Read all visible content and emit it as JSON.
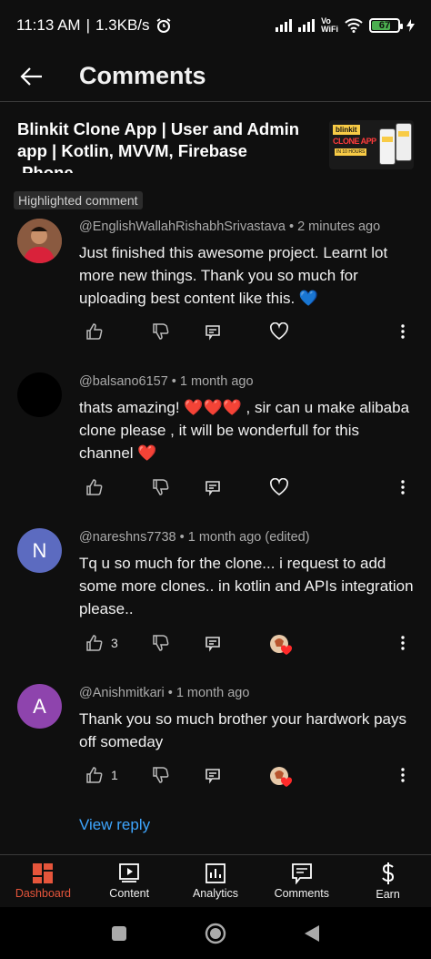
{
  "status_bar": {
    "time": "11:13 AM",
    "speed": "1.3KB/s",
    "volte": "Vo\nWiFi",
    "battery": "67"
  },
  "header": {
    "title": "Comments"
  },
  "video": {
    "title": "Blinkit Clone App | User and Admin app | Kotlin, MVVM, Firebase ,Phone…",
    "thumb_logo": "blinkit",
    "thumb_text": "CLONE APP",
    "thumb_sub": "IN 10 HOURS"
  },
  "highlight_badge": "Highlighted comment",
  "comments": [
    {
      "author": "@EnglishWallahRishabhSrivastava • 2 minutes ago",
      "text": "Just finished this awesome project. Learnt lot more new things. Thank you so much for uploading best content like this. 💙",
      "avatar_color": "#6b3a2a",
      "avatar_letter": "",
      "likes": "",
      "heart": "outline"
    },
    {
      "author": "@balsano6157 • 1 month ago",
      "text": "thats  amazing! ❤️❤️❤️ , sir can u make alibaba clone please , it will be wonderfull for this channel ❤️",
      "avatar_color": "#000000",
      "avatar_letter": "",
      "likes": "",
      "heart": "outline"
    },
    {
      "author": "@nareshns7738 • 1 month ago (edited)",
      "text": "Tq u so much for the clone... i request to add some more clones.. in kotlin and APIs integration please..",
      "avatar_color": "#5c6bc0",
      "avatar_letter": "N",
      "likes": "3",
      "heart": "filled"
    },
    {
      "author": "@Anishmitkari • 1 month ago",
      "text": "Thank you so much brother your hardwork pays off someday",
      "avatar_color": "#8e44ad",
      "avatar_letter": "A",
      "likes": "1",
      "heart": "filled"
    }
  ],
  "view_reply": "View reply",
  "bottom_nav": [
    {
      "label": "Dashboard",
      "icon": "dashboard-icon",
      "active": true
    },
    {
      "label": "Content",
      "icon": "content-icon",
      "active": false
    },
    {
      "label": "Analytics",
      "icon": "analytics-icon",
      "active": false
    },
    {
      "label": "Comments",
      "icon": "comments-icon",
      "active": false
    },
    {
      "label": "Earn",
      "icon": "earn-icon",
      "active": false
    }
  ],
  "colors": {
    "accent": "#e6553b",
    "link": "#3ea6ff",
    "background": "#0f0f0f"
  }
}
